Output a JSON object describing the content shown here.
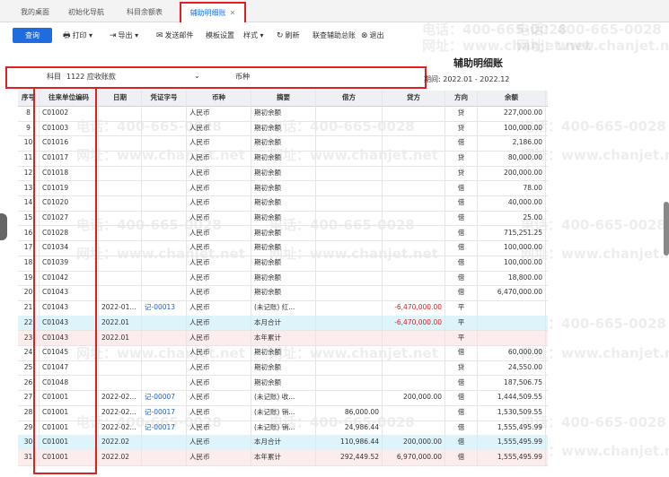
{
  "tabs": [
    {
      "label": "我的桌面",
      "active": false
    },
    {
      "label": "初始化导航",
      "active": false
    },
    {
      "label": "科目余额表",
      "active": false
    },
    {
      "label": "辅助明细账",
      "active": true
    }
  ],
  "toolbar": {
    "query": "查询",
    "print": "打印",
    "export": "导出",
    "send_email": "发送邮件",
    "template": "模板设置",
    "style": "样式",
    "refresh": "刷新",
    "total": "联查辅助总账",
    "exit": "退出"
  },
  "report_title": "辅助明细账",
  "filter": {
    "subject_label": "科目",
    "subject_value": "1122 应收账款",
    "currency_label": "币种",
    "currency_value": ""
  },
  "period": "期间: 2022.01 - 2022.12",
  "columns": [
    "序号",
    "往来单位编码",
    "日期",
    "凭证字号",
    "币种",
    "摘要",
    "借方",
    "贷方",
    "方向",
    "余额"
  ],
  "rows": [
    {
      "no": "8",
      "code": "C01002",
      "date": "",
      "voucher": "",
      "cur": "人民币",
      "summary": "期初余额",
      "debit": "",
      "credit": "",
      "dir": "贷",
      "bal": "227,000.00",
      "style": ""
    },
    {
      "no": "9",
      "code": "C01003",
      "date": "",
      "voucher": "",
      "cur": "人民币",
      "summary": "期初余额",
      "debit": "",
      "credit": "",
      "dir": "贷",
      "bal": "100,000.00",
      "style": ""
    },
    {
      "no": "10",
      "code": "C01016",
      "date": "",
      "voucher": "",
      "cur": "人民币",
      "summary": "期初余额",
      "debit": "",
      "credit": "",
      "dir": "借",
      "bal": "2,186.00",
      "style": ""
    },
    {
      "no": "11",
      "code": "C01017",
      "date": "",
      "voucher": "",
      "cur": "人民币",
      "summary": "期初余额",
      "debit": "",
      "credit": "",
      "dir": "贷",
      "bal": "80,000.00",
      "style": ""
    },
    {
      "no": "12",
      "code": "C01018",
      "date": "",
      "voucher": "",
      "cur": "人民币",
      "summary": "期初余额",
      "debit": "",
      "credit": "",
      "dir": "贷",
      "bal": "200,000.00",
      "style": ""
    },
    {
      "no": "13",
      "code": "C01019",
      "date": "",
      "voucher": "",
      "cur": "人民币",
      "summary": "期初余额",
      "debit": "",
      "credit": "",
      "dir": "借",
      "bal": "78.00",
      "style": ""
    },
    {
      "no": "14",
      "code": "C01020",
      "date": "",
      "voucher": "",
      "cur": "人民币",
      "summary": "期初余额",
      "debit": "",
      "credit": "",
      "dir": "借",
      "bal": "40,000.00",
      "style": ""
    },
    {
      "no": "15",
      "code": "C01027",
      "date": "",
      "voucher": "",
      "cur": "人民币",
      "summary": "期初余额",
      "debit": "",
      "credit": "",
      "dir": "借",
      "bal": "25.00",
      "style": ""
    },
    {
      "no": "16",
      "code": "C01028",
      "date": "",
      "voucher": "",
      "cur": "人民币",
      "summary": "期初余额",
      "debit": "",
      "credit": "",
      "dir": "借",
      "bal": "715,251.25",
      "style": ""
    },
    {
      "no": "17",
      "code": "C01034",
      "date": "",
      "voucher": "",
      "cur": "人民币",
      "summary": "期初余额",
      "debit": "",
      "credit": "",
      "dir": "借",
      "bal": "100,000.00",
      "style": ""
    },
    {
      "no": "18",
      "code": "C01039",
      "date": "",
      "voucher": "",
      "cur": "人民币",
      "summary": "期初余额",
      "debit": "",
      "credit": "",
      "dir": "借",
      "bal": "100,000.00",
      "style": ""
    },
    {
      "no": "19",
      "code": "C01042",
      "date": "",
      "voucher": "",
      "cur": "人民币",
      "summary": "期初余额",
      "debit": "",
      "credit": "",
      "dir": "借",
      "bal": "18,800.00",
      "style": ""
    },
    {
      "no": "20",
      "code": "C01043",
      "date": "",
      "voucher": "",
      "cur": "人民币",
      "summary": "期初余额",
      "debit": "",
      "credit": "",
      "dir": "借",
      "bal": "6,470,000.00",
      "style": ""
    },
    {
      "no": "21",
      "code": "C01043",
      "date": "2022-01...",
      "voucher": "记-00013",
      "cur": "人民币",
      "summary": "(未记账) 红...",
      "debit": "",
      "credit": "-6,470,000.00",
      "dir": "平",
      "bal": "",
      "style": "",
      "creditRed": true
    },
    {
      "no": "22",
      "code": "C01043",
      "date": "2022.01",
      "voucher": "",
      "cur": "人民币",
      "summary": "本月合计",
      "debit": "",
      "credit": "-6,470,000.00",
      "dir": "平",
      "bal": "",
      "style": "cyan",
      "creditRed": true
    },
    {
      "no": "23",
      "code": "C01043",
      "date": "2022.01",
      "voucher": "",
      "cur": "人民币",
      "summary": "本年累计",
      "debit": "",
      "credit": "",
      "dir": "平",
      "bal": "",
      "style": "pink"
    },
    {
      "no": "24",
      "code": "C01045",
      "date": "",
      "voucher": "",
      "cur": "人民币",
      "summary": "期初余额",
      "debit": "",
      "credit": "",
      "dir": "借",
      "bal": "60,000.00",
      "style": ""
    },
    {
      "no": "25",
      "code": "C01047",
      "date": "",
      "voucher": "",
      "cur": "人民币",
      "summary": "期初余额",
      "debit": "",
      "credit": "",
      "dir": "贷",
      "bal": "24,550.00",
      "style": ""
    },
    {
      "no": "26",
      "code": "C01048",
      "date": "",
      "voucher": "",
      "cur": "人民币",
      "summary": "期初余额",
      "debit": "",
      "credit": "",
      "dir": "借",
      "bal": "187,506.75",
      "style": ""
    },
    {
      "no": "27",
      "code": "C01001",
      "date": "2022-02...",
      "voucher": "记-00007",
      "cur": "人民币",
      "summary": "(未记账) 收...",
      "debit": "",
      "credit": "200,000.00",
      "dir": "借",
      "bal": "1,444,509.55",
      "style": ""
    },
    {
      "no": "28",
      "code": "C01001",
      "date": "2022-02...",
      "voucher": "记-00017",
      "cur": "人民币",
      "summary": "(未记账) 销...",
      "debit": "86,000.00",
      "credit": "",
      "dir": "借",
      "bal": "1,530,509.55",
      "style": ""
    },
    {
      "no": "29",
      "code": "C01001",
      "date": "2022-02...",
      "voucher": "记-00017",
      "cur": "人民币",
      "summary": "(未记账) 销...",
      "debit": "24,986.44",
      "credit": "",
      "dir": "借",
      "bal": "1,555,495.99",
      "style": ""
    },
    {
      "no": "30",
      "code": "C01001",
      "date": "2022.02",
      "voucher": "",
      "cur": "人民币",
      "summary": "本月合计",
      "debit": "110,986.44",
      "credit": "200,000.00",
      "dir": "借",
      "bal": "1,555,495.99",
      "style": "cyan"
    },
    {
      "no": "31",
      "code": "C01001",
      "date": "2022.02",
      "voucher": "",
      "cur": "人民币",
      "summary": "本年累计",
      "debit": "292,449.52",
      "credit": "6,970,000.00",
      "dir": "借",
      "bal": "1,555,495.99",
      "style": "pink"
    }
  ],
  "watermarks": [
    "电话：400-665-0028",
    "网址：www.chanjet.net"
  ]
}
